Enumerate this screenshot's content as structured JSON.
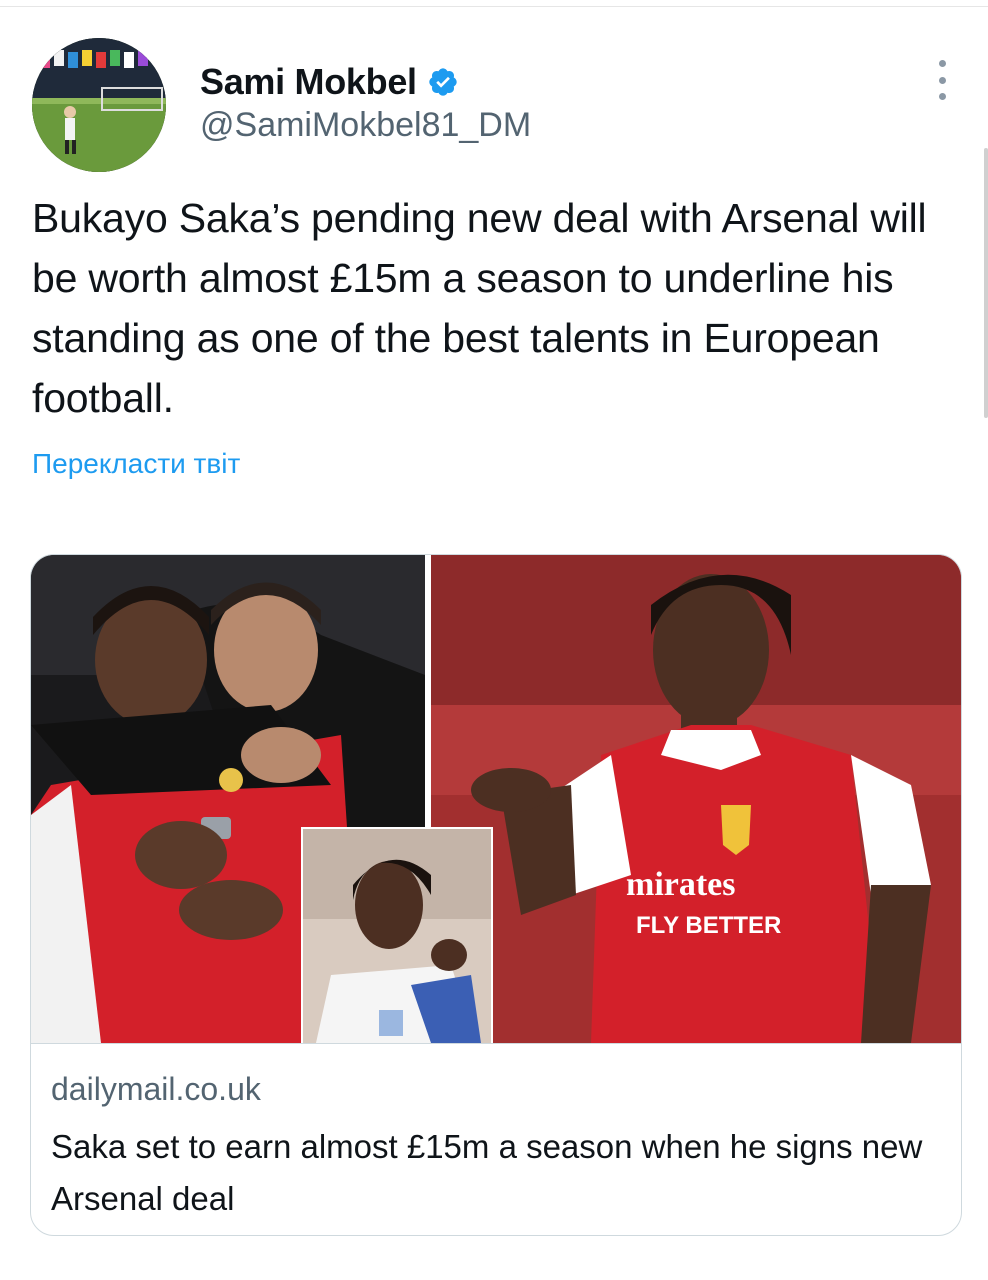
{
  "tweet": {
    "author": {
      "name": "Sami Mokbel",
      "handle": "@SamiMokbel81_DM",
      "verified": true,
      "avatar_icon": "avatar-photo"
    },
    "more_icon": "more-vertical-icon",
    "text": "Bukayo Saka’s pending new deal with Arsenal will be worth almost £15m a season to underline his standing as one of the best talents in European football.",
    "translate_label": "Перекласти твіт"
  },
  "card": {
    "domain": "dailymail.co.uk",
    "title": "Saka set to earn almost £15m a season when he signs new Arsenal deal",
    "image": {
      "jersey_sponsor_line1": "mirates",
      "jersey_sponsor_line2": "FLY BETTER"
    }
  },
  "colors": {
    "accent": "#1d9bf0",
    "secondary_text": "#536471",
    "border": "#cfd9de",
    "arsenal_red": "#d3202a"
  }
}
